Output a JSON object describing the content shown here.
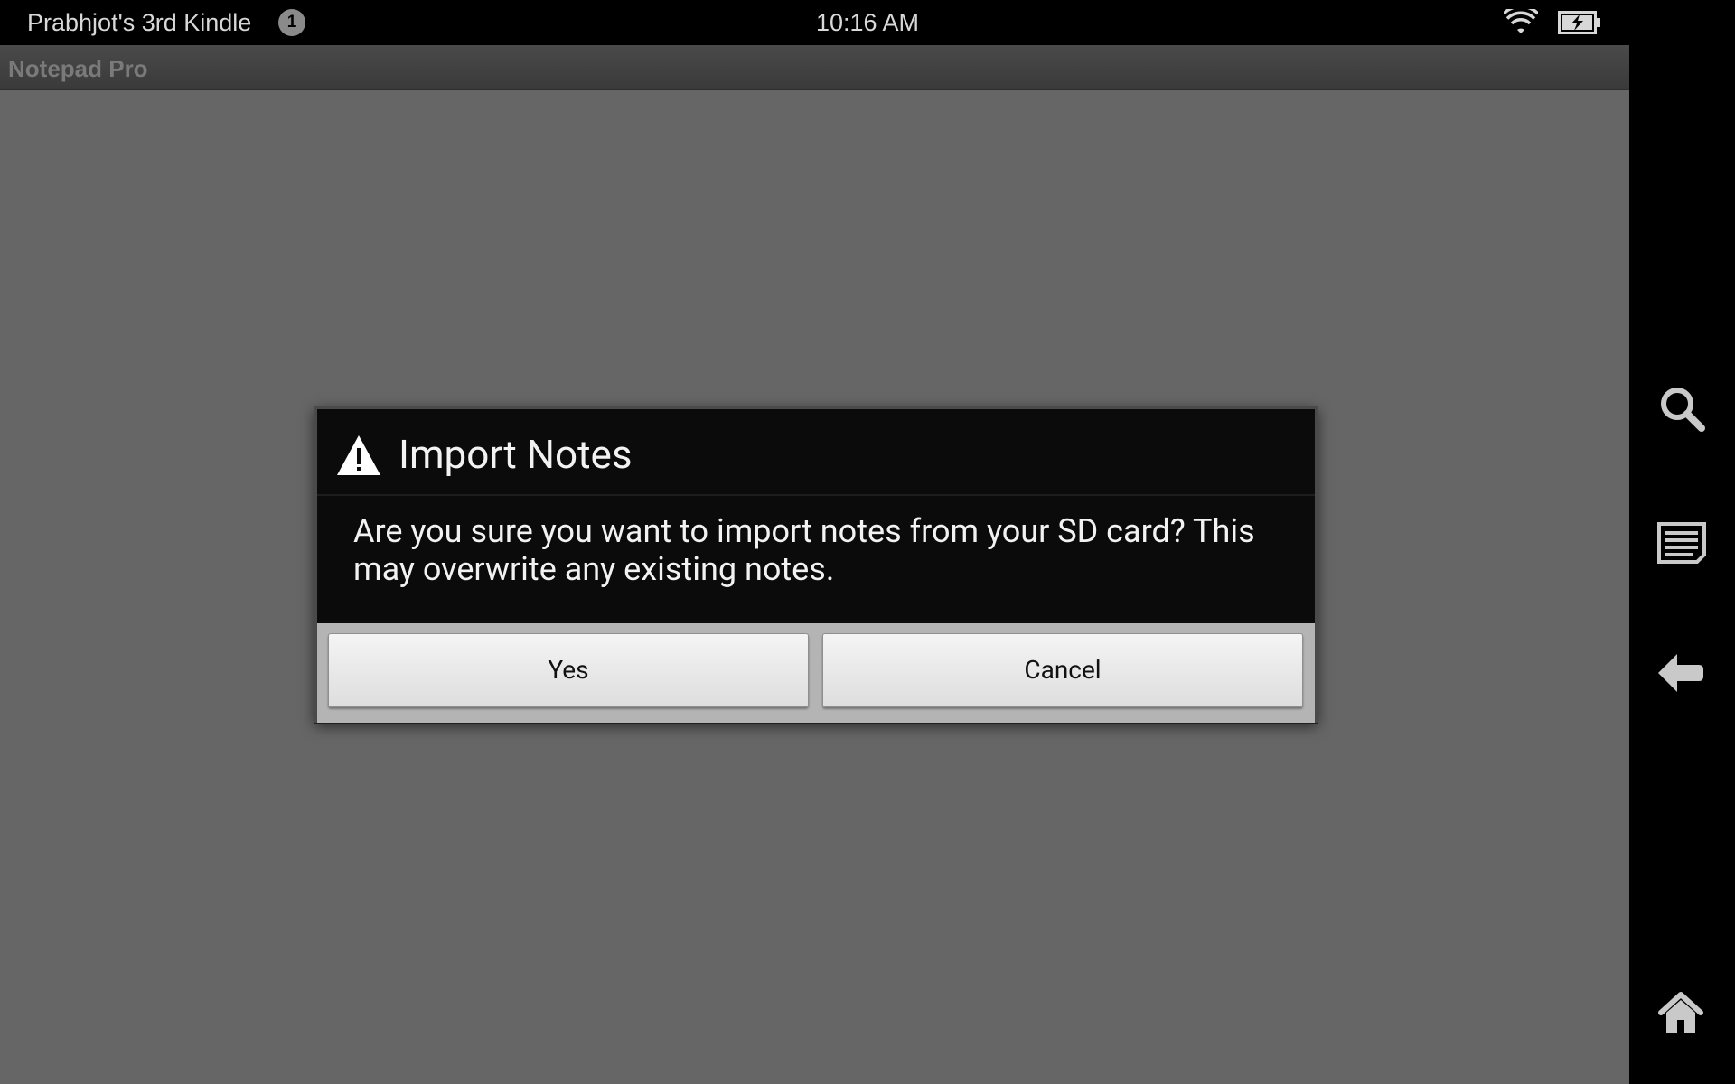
{
  "status_bar": {
    "device_name": "Prabhjot's 3rd Kindle",
    "notification_count": "1",
    "time": "10:16 AM",
    "wifi_icon": "wifi-icon",
    "battery_icon": "battery-charging-icon"
  },
  "title_bar": {
    "app_title": "Notepad Pro"
  },
  "dialog": {
    "icon": "warning-icon",
    "title": "Import Notes",
    "message": "Are you sure you want to import notes from your SD card? This may overwrite any existing notes.",
    "buttons": {
      "yes_label": "Yes",
      "cancel_label": "Cancel"
    }
  },
  "nav_bar": {
    "items": [
      "search-icon",
      "menu-icon",
      "back-icon",
      "home-icon"
    ]
  },
  "colors": {
    "content_background": "#666666",
    "dialog_background": "#0b0b0b",
    "button_bar": "#b4b4b4"
  }
}
